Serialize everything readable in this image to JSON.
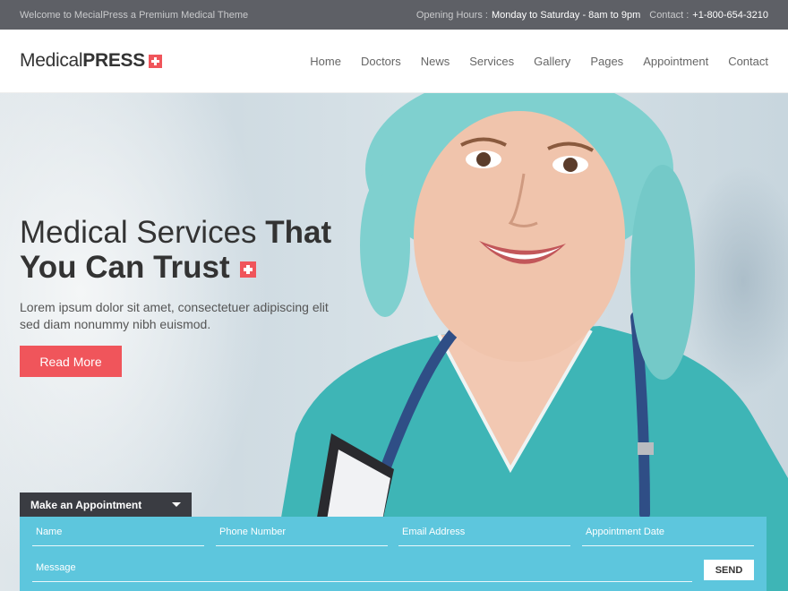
{
  "topbar": {
    "welcome": "Welcome to MecialPress a Premium Medical Theme",
    "hours_label": "Opening Hours :",
    "hours_value": "Monday to Saturday - 8am to 9pm",
    "contact_label": "Contact :",
    "contact_value": "+1-800-654-3210"
  },
  "logo": {
    "light": "Medical",
    "bold": "PRESS"
  },
  "nav": [
    "Home",
    "Doctors",
    "News",
    "Services",
    "Gallery",
    "Pages",
    "Appointment",
    "Contact"
  ],
  "hero": {
    "title_light": "Medical Services ",
    "title_bold_1": "That",
    "title_bold_2": "You Can Trust",
    "text": "Lorem ipsum dolor sit amet, consectetuer adipiscing elit sed diam nonummy nibh euismod.",
    "button": "Read More"
  },
  "appointment": {
    "tab_label": "Make an Appointment",
    "fields": [
      "Name",
      "Phone Number",
      "Email Address",
      "Appointment Date",
      "Message"
    ],
    "send": "SEND"
  },
  "colors": {
    "accent": "#f0555b",
    "form": "#5dc6dd",
    "topbar": "#5e6066",
    "dark": "#3a3c42"
  }
}
